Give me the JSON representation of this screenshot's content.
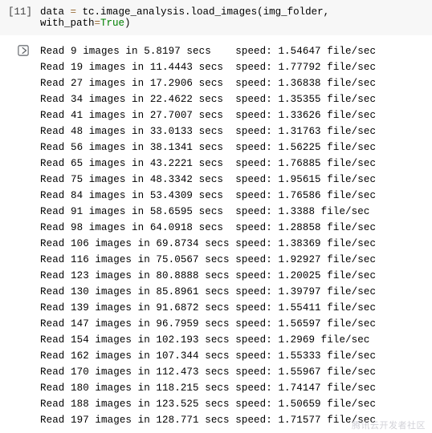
{
  "cell": {
    "prompt_label": "[11]",
    "code": {
      "lhs": "data",
      "assign": " = ",
      "call_chain": "tc.image_analysis.load_images",
      "open": "(",
      "arg1": "img_folder",
      "sep": ", ",
      "kwarg_name": "with_path",
      "eq": "=",
      "kwarg_val": "True",
      "close": ")"
    }
  },
  "output_lines": [
    "Read 9 images in 5.8197 secs    speed: 1.54647 file/sec",
    "Read 19 images in 11.4443 secs  speed: 1.77792 file/sec",
    "Read 27 images in 17.2906 secs  speed: 1.36838 file/sec",
    "Read 34 images in 22.4622 secs  speed: 1.35355 file/sec",
    "Read 41 images in 27.7007 secs  speed: 1.33626 file/sec",
    "Read 48 images in 33.0133 secs  speed: 1.31763 file/sec",
    "Read 56 images in 38.1341 secs  speed: 1.56225 file/sec",
    "Read 65 images in 43.2221 secs  speed: 1.76885 file/sec",
    "Read 75 images in 48.3342 secs  speed: 1.95615 file/sec",
    "Read 84 images in 53.4309 secs  speed: 1.76586 file/sec",
    "Read 91 images in 58.6595 secs  speed: 1.3388 file/sec",
    "Read 98 images in 64.0918 secs  speed: 1.28858 file/sec",
    "Read 106 images in 69.8734 secs speed: 1.38369 file/sec",
    "Read 116 images in 75.0567 secs speed: 1.92927 file/sec",
    "Read 123 images in 80.8888 secs speed: 1.20025 file/sec",
    "Read 130 images in 85.8961 secs speed: 1.39797 file/sec",
    "Read 139 images in 91.6872 secs speed: 1.55411 file/sec",
    "Read 147 images in 96.7959 secs speed: 1.56597 file/sec",
    "Read 154 images in 102.193 secs speed: 1.2969 file/sec",
    "Read 162 images in 107.344 secs speed: 1.55333 file/sec",
    "Read 170 images in 112.473 secs speed: 1.55967 file/sec",
    "Read 180 images in 118.215 secs speed: 1.74147 file/sec",
    "Read 188 images in 123.525 secs speed: 1.50659 file/sec",
    "Read 197 images in 128.771 secs speed: 1.71577 file/sec"
  ],
  "watermark": "腾讯云开发者社区"
}
